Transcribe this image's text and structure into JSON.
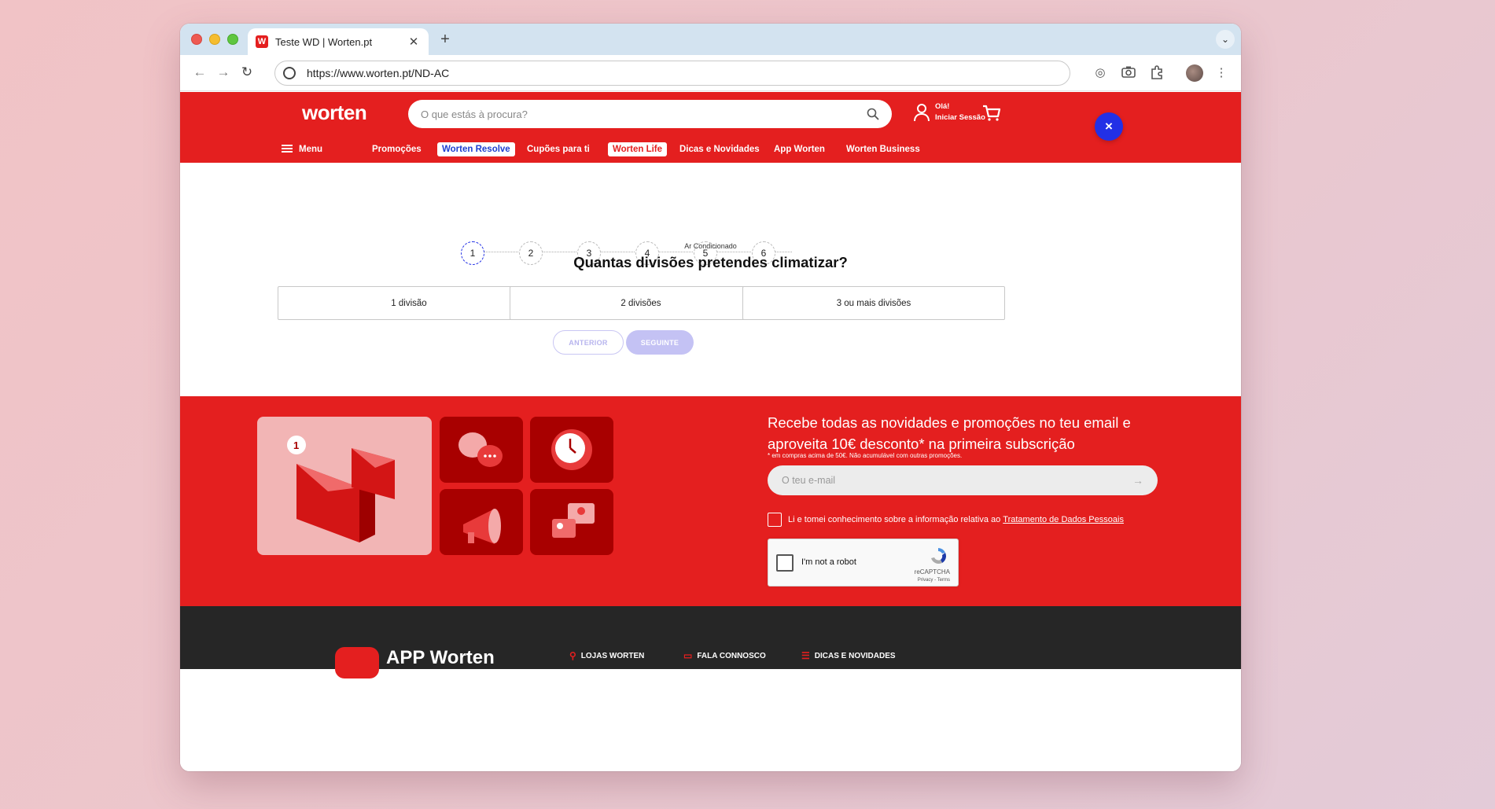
{
  "browser": {
    "tab_title": "Teste WD | Worten.pt",
    "favicon": "W",
    "url": "https://www.worten.pt/ND-AC"
  },
  "header": {
    "logo": "worten",
    "search_placeholder": "O que estás à procura?",
    "login_greeting": "Olá!",
    "login_action": "Iniciar Sessão"
  },
  "nav": {
    "menu": "Menu",
    "items": [
      "Promoções",
      "Worten Resolve",
      "Cupões para ti",
      "Worten Life",
      "Dicas e Novidades",
      "App Worten",
      "Worten Business"
    ]
  },
  "wizard": {
    "steps": [
      "1",
      "2",
      "3",
      "4",
      "5",
      "6"
    ],
    "active_step": 1,
    "category": "Ar Condicionado",
    "question": "Quantas divisões pretendes climatizar?",
    "options": [
      "1 divisão",
      "2 divisões",
      "3 ou mais divisões"
    ],
    "prev_label": "ANTERIOR",
    "next_label": "SEGUINTE",
    "close_label": "×"
  },
  "newsletter": {
    "title": "Recebe todas as novidades e promoções no teu email e aproveita 10€ desconto* na primeira subscrição",
    "note": "* em compras acima de 50€. Não acumulável com outras promoções.",
    "email_placeholder": "O teu e-mail",
    "consent_text": "Li e tomei conhecimento sobre a informação relativa ao",
    "consent_link": "Tratamento de Dados Pessoais",
    "captcha_label": "I'm not a robot",
    "captcha_brand": "reCAPTCHA",
    "captcha_terms": "Privacy - Terms"
  },
  "footer": {
    "app_title": "APP Worten",
    "links": [
      "LOJAS WORTEN",
      "FALA CONNOSCO",
      "DICAS E NOVIDADES"
    ]
  },
  "colors": {
    "brand_red": "#e41f1f",
    "accent_blue": "#2230e6"
  }
}
